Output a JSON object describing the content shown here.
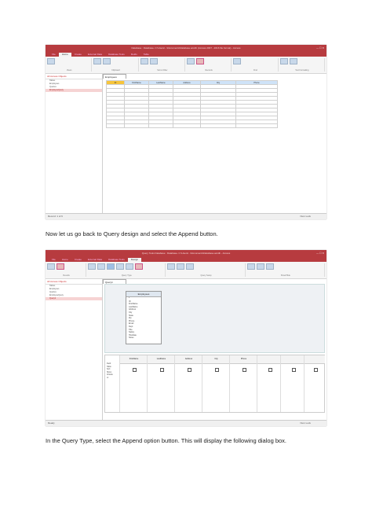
{
  "paragraphs": {
    "p1": "Now let us go back to Query design and select the Append button.",
    "p2": "In the Query Type, select the Append option button. This will display the following dialog box."
  },
  "shot1": {
    "window_title": "Database : Database- C:\\Users\\...\\Documents\\Database.accdb (Access 2007 - 2016 file format) - Access",
    "tabs": [
      "File",
      "Home",
      "Create",
      "External Data",
      "Database Tools",
      "Fields",
      "Table"
    ],
    "active_tab": "Home",
    "ribbon_groups": [
      "Views",
      "Clipboard",
      "Sort & Filter",
      "Records",
      "Find",
      "Text Formatting"
    ],
    "nav_header": "All Access Objects",
    "nav_items": [
      "Tables",
      "Employees",
      "Queries",
      "EmployeeQuery"
    ],
    "selected_nav": "EmployeeQuery",
    "doc_tab": "Employees",
    "grid_headers": [
      "ID",
      "FirstName",
      "LastName",
      "Address",
      "City",
      "Phone"
    ],
    "status_left": "Record: 1 of 9",
    "status_right": "Num Lock"
  },
  "shot2": {
    "window_title": "Query Tools  Database : Database- C:\\Users\\...\\Documents\\Database.accdb - Access",
    "tabs": [
      "File",
      "Home",
      "Create",
      "External Data",
      "Database Tools",
      "Design"
    ],
    "active_tab": "Design",
    "ribbon_groups": [
      "Results",
      "Query Type",
      "Query Setup",
      "Show/Hide"
    ],
    "nav_header": "All Access Objects",
    "nav_items": [
      "Tables",
      "Employees",
      "Queries",
      "EmployeeQuery",
      "Query1"
    ],
    "selected_nav": "Query1",
    "doc_tab": "Query1",
    "table_box_title": "Employees",
    "table_box_fields": [
      "*",
      "ID",
      "FirstName",
      "LastName",
      "Address",
      "City",
      "State",
      "Zip",
      "Phone",
      "Email",
      "Dept",
      "Title",
      "Salary",
      "HireDate",
      "Notes"
    ],
    "grid_row_labels": [
      "Field:",
      "Table:",
      "Sort:",
      "Show:",
      "Criteria:",
      "or:"
    ],
    "grid_columns": [
      "FirstName",
      "LastName",
      "Address",
      "City",
      "Phone",
      "",
      "",
      ""
    ],
    "status_left": "Ready",
    "status_right": "Num Lock"
  }
}
